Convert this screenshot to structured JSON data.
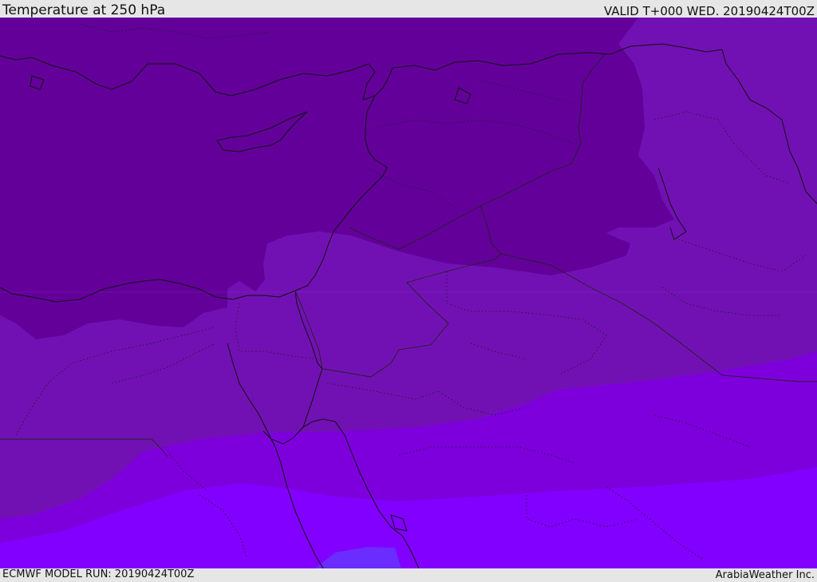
{
  "header": {
    "title": "Temperature at 250 hPa",
    "valid": "VALID T+000 WED. 20190424T00Z"
  },
  "footer": {
    "model_run": "ECMWF MODEL RUN: 20190424T00Z",
    "credit": "ArabiaWeather Inc."
  },
  "colors": {
    "band_coldest": "#63009a",
    "band_cold": "#7211b3",
    "band_mid": "#7d00dc",
    "band_warm": "#8200ff",
    "band_warmest": "#6a2cff",
    "coastline": "#111111",
    "border": "#222222"
  }
}
